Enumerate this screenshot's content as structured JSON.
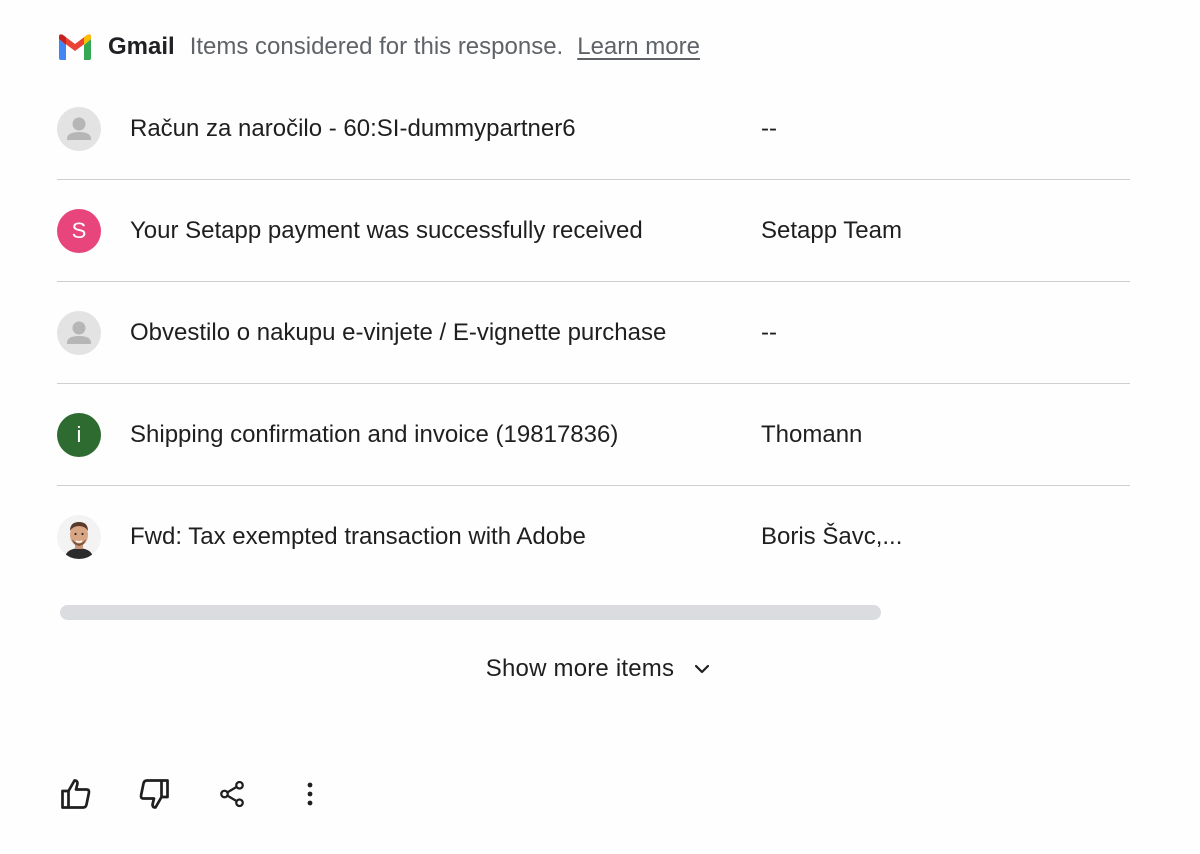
{
  "header": {
    "app_name": "Gmail",
    "description": "Items considered for this response.",
    "learn_more": "Learn more"
  },
  "items": [
    {
      "avatar_type": "generic",
      "avatar_letter": "",
      "avatar_color": "#e3e3e3",
      "subject": "Račun za naročilo - 60:SI-dummypartner6",
      "sender": "--"
    },
    {
      "avatar_type": "letter",
      "avatar_letter": "S",
      "avatar_color": "#e8457c",
      "subject": "Your Setapp payment was successfully received",
      "sender": "Setapp Team"
    },
    {
      "avatar_type": "generic",
      "avatar_letter": "",
      "avatar_color": "#e3e3e3",
      "subject": "Obvestilo o nakupu e-vinjete / E-vignette purchase",
      "sender": "--"
    },
    {
      "avatar_type": "letter",
      "avatar_letter": "i",
      "avatar_color": "#2e6b30",
      "subject": "Shipping confirmation and invoice (19817836)",
      "sender": "Thomann"
    },
    {
      "avatar_type": "photo",
      "avatar_letter": "",
      "avatar_color": "#c9a183",
      "subject": "Fwd: Tax exempted transaction with Adobe",
      "sender": "Boris Šavc,..."
    }
  ],
  "show_more": "Show more items",
  "icons": {
    "logo": "gmail-logo-icon",
    "expand": "chevron-down-icon",
    "actions": [
      "thumbs-up-icon",
      "thumbs-down-icon",
      "share-icon",
      "more-vert-icon"
    ]
  },
  "colors": {
    "gmail_red": "#ea4335",
    "gmail_blue": "#4285f4",
    "gmail_green": "#34a853",
    "gmail_yellow": "#fbbc04",
    "divider": "#cfcfcf",
    "muted_text": "#5f6368"
  }
}
